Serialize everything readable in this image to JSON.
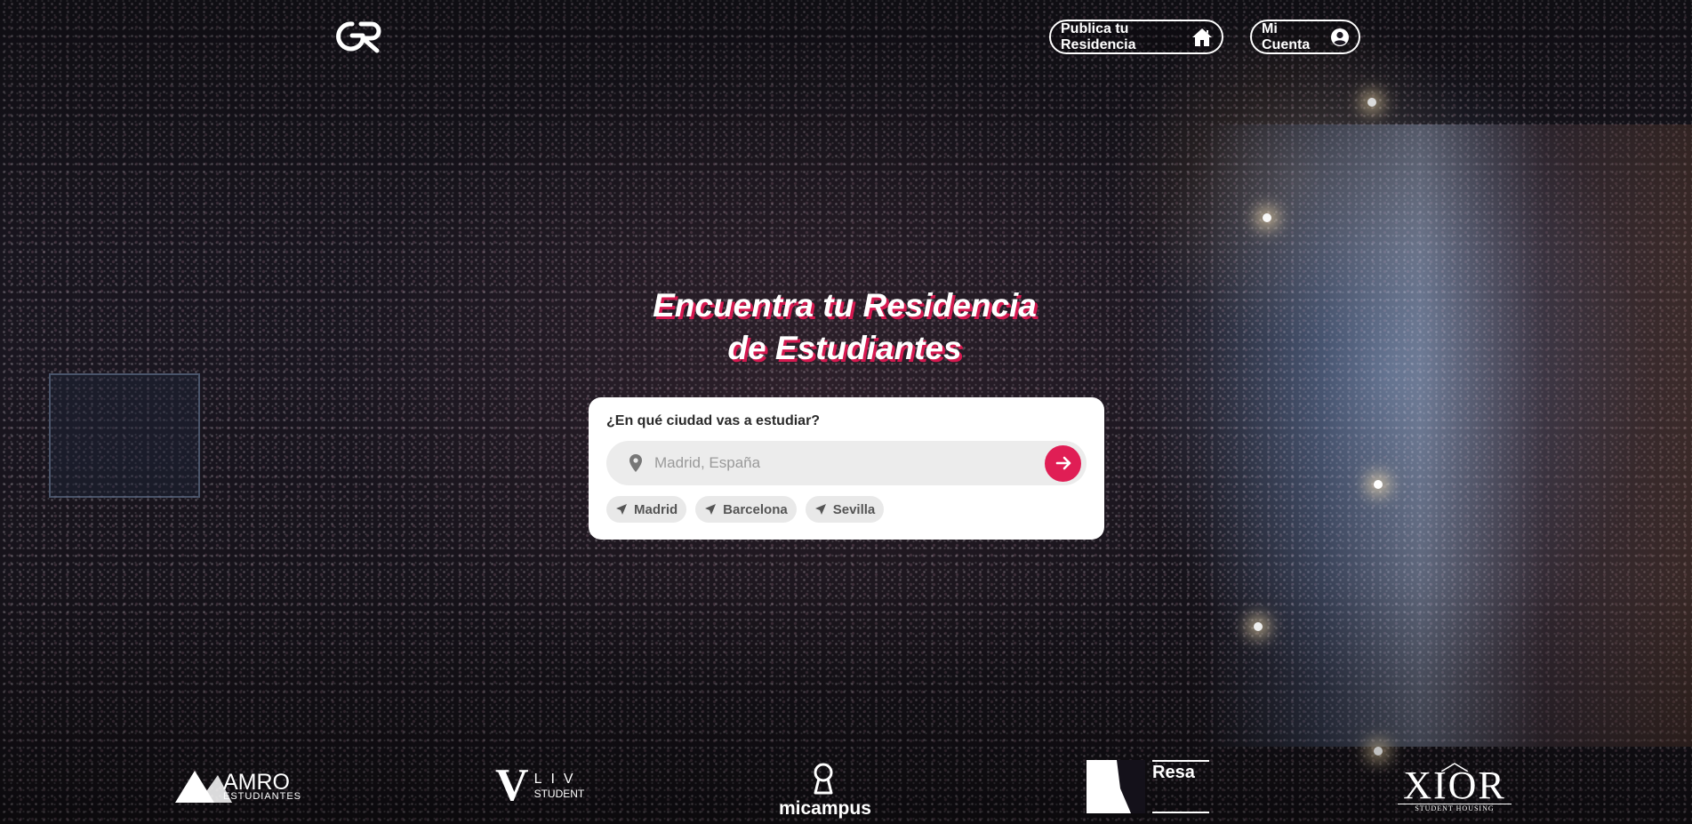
{
  "header": {
    "logo_text": "GR",
    "publish_label": "Publica tu Residencia",
    "account_label": "Mi Cuenta"
  },
  "hero": {
    "title_line1": "Encuentra tu Residencia",
    "title_line2": "de Estudiantes"
  },
  "search": {
    "label": "¿En qué ciudad vas a estudiar?",
    "placeholder": "Madrid, España",
    "value": "",
    "quick_cities": [
      {
        "label": "Madrid"
      },
      {
        "label": "Barcelona"
      },
      {
        "label": "Sevilla"
      }
    ]
  },
  "partners": {
    "amro": {
      "word": "AMRO",
      "sub": "ESTUDIANTES"
    },
    "liv": {
      "big": "V",
      "word": "LIV",
      "sub": "STUDENT"
    },
    "micampus": {
      "word": "micampus"
    },
    "resa": {
      "word": "Resa"
    },
    "xior": {
      "word": "XIOR",
      "sub": "STUDENT HOUSING"
    }
  },
  "colors": {
    "accent": "#e01e55",
    "title_shadow": "#d5184f",
    "card_bg": "#ffffff",
    "input_bg": "#ececec"
  },
  "icons": {
    "publish": "home-icon",
    "account": "user-circle-icon",
    "location": "map-pin-icon",
    "submit": "arrow-right-icon",
    "city": "navigation-arrow-icon"
  }
}
